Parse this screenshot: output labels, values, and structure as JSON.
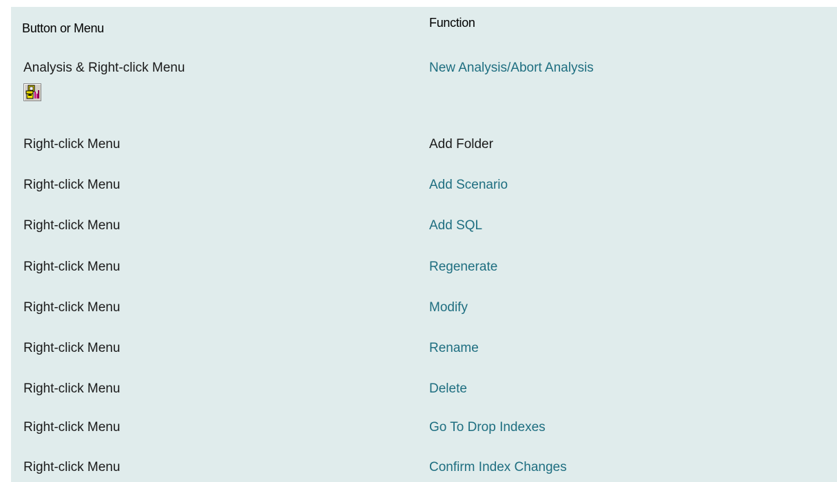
{
  "table": {
    "headers": {
      "col1": "Button or Menu",
      "col2": "Function"
    },
    "rows": [
      {
        "button_or_menu": "Analysis & Right-click Menu",
        "function": "New Analysis/Abort Analysis",
        "is_link": true,
        "icon": "analysis-wizard-icon"
      },
      {
        "button_or_menu": "Right-click Menu",
        "function": "Add Folder",
        "is_link": false
      },
      {
        "button_or_menu": "Right-click Menu",
        "function": "Add Scenario",
        "is_link": true
      },
      {
        "button_or_menu": "Right-click Menu",
        "function": "Add SQL",
        "is_link": true
      },
      {
        "button_or_menu": "Right-click Menu",
        "function": "Regenerate",
        "is_link": true
      },
      {
        "button_or_menu": "Right-click Menu",
        "function": "Modify",
        "is_link": true
      },
      {
        "button_or_menu": "Right-click Menu",
        "function": "Rename",
        "is_link": true
      },
      {
        "button_or_menu": "Right-click Menu",
        "function": "Delete",
        "is_link": true
      },
      {
        "button_or_menu": "Right-click Menu",
        "function": "Go To Drop Indexes",
        "is_link": true
      },
      {
        "button_or_menu": "Right-click Menu",
        "function": "Confirm Index Changes",
        "is_link": true
      }
    ]
  },
  "colors": {
    "table_background": "#e0ecec",
    "link_color": "#1e6e80",
    "text_color": "#1a1a1a"
  }
}
